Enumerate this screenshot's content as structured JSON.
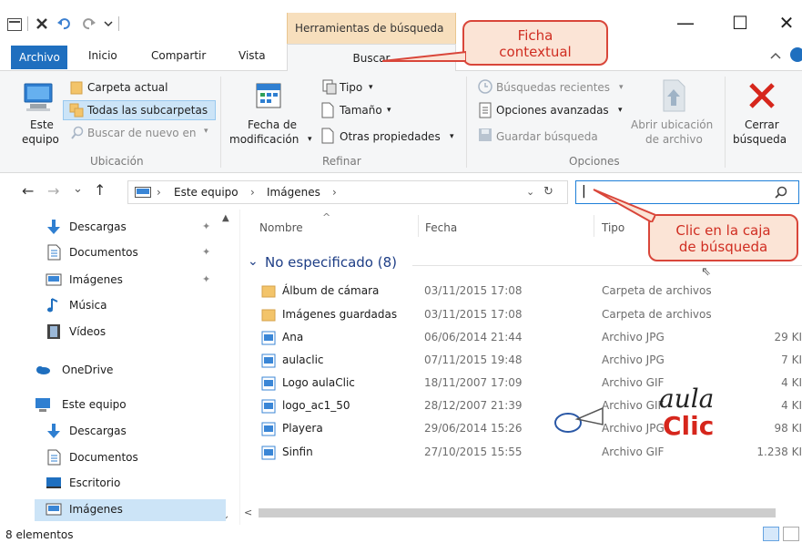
{
  "quick_access": {
    "undo_icon": "undo-arrow-icon",
    "redo_icon": "redo-arrow-icon"
  },
  "window": {
    "contextual_tab_group": "Herramientas de búsqueda",
    "minimize": "—",
    "maximize": "☐",
    "close": "✕"
  },
  "tabs": {
    "archivo": "Archivo",
    "inicio": "Inicio",
    "compartir": "Compartir",
    "vista": "Vista",
    "buscar": "Buscar"
  },
  "ribbon": {
    "ubicacion": {
      "este_equipo_line1": "Este",
      "este_equipo_line2": "equipo",
      "carpeta_actual": "Carpeta actual",
      "todas_subcarpetas": "Todas las subcarpetas",
      "buscar_de_nuevo": "Buscar de nuevo en",
      "group_label": "Ubicación"
    },
    "refinar": {
      "fecha_line1": "Fecha de",
      "fecha_line2": "modificación",
      "tipo": "Tipo",
      "tamano": "Tamaño",
      "otras_propiedades": "Otras propiedades",
      "group_label": "Refinar"
    },
    "opciones": {
      "busquedas_recientes": "Búsquedas recientes",
      "opciones_avanzadas": "Opciones avanzadas",
      "guardar_busqueda": "Guardar búsqueda",
      "abrir_ubicacion_line1": "Abrir ubicación",
      "abrir_ubicacion_line2": "de archivo",
      "group_label": "Opciones"
    },
    "cerrar": {
      "line1": "Cerrar",
      "line2": "búsqueda"
    }
  },
  "address_bar": {
    "back": "←",
    "forward": "→",
    "recent": "⌄",
    "up": "↑",
    "crumbs": [
      "Este equipo",
      "Imágenes"
    ],
    "separator": "›",
    "search_value": "|"
  },
  "nav_pane": {
    "items": [
      {
        "label": "Descargas",
        "icon": "download-arrow-icon",
        "pinned": true
      },
      {
        "label": "Documentos",
        "icon": "document-icon",
        "pinned": true
      },
      {
        "label": "Imágenes",
        "icon": "images-folder-icon",
        "pinned": true
      },
      {
        "label": "Música",
        "icon": "music-note-icon",
        "pinned": false
      },
      {
        "label": "Vídeos",
        "icon": "video-icon",
        "pinned": false
      },
      {
        "label": "OneDrive",
        "icon": "cloud-icon",
        "pinned": false
      },
      {
        "label": "Este equipo",
        "icon": "computer-icon",
        "pinned": false
      },
      {
        "label": "Descargas",
        "icon": "download-arrow-icon",
        "pinned": false
      },
      {
        "label": "Documentos",
        "icon": "document-icon",
        "pinned": false
      },
      {
        "label": "Escritorio",
        "icon": "desktop-icon",
        "pinned": false
      },
      {
        "label": "Imágenes",
        "icon": "images-folder-icon",
        "pinned": false
      }
    ]
  },
  "columns": {
    "nombre": "Nombre",
    "fecha": "Fecha",
    "tipo": "Tipo"
  },
  "group": {
    "label": "No especificado (8)"
  },
  "files": [
    {
      "name": "Álbum de cámara",
      "date": "03/11/2015 17:08",
      "type": "Carpeta de archivos",
      "size": "",
      "icon": "folder-icon"
    },
    {
      "name": "Imágenes guardadas",
      "date": "03/11/2015 17:08",
      "type": "Carpeta de archivos",
      "size": "",
      "icon": "folder-icon"
    },
    {
      "name": "Ana",
      "date": "06/06/2014 21:44",
      "type": "Archivo JPG",
      "size": "29 KI",
      "icon": "image-file-icon"
    },
    {
      "name": "aulaclic",
      "date": "07/11/2015 19:48",
      "type": "Archivo JPG",
      "size": "7 KI",
      "icon": "image-file-icon"
    },
    {
      "name": "Logo aulaClic",
      "date": "18/11/2007 17:09",
      "type": "Archivo GIF",
      "size": "4 KI",
      "icon": "image-file-icon"
    },
    {
      "name": "logo_ac1_50",
      "date": "28/12/2007 21:39",
      "type": "Archivo GIF",
      "size": "4 KI",
      "icon": "image-file-icon"
    },
    {
      "name": "Playera",
      "date": "29/06/2014 15:26",
      "type": "Archivo JPG",
      "size": "98 KI",
      "icon": "image-file-icon"
    },
    {
      "name": "Sinfin",
      "date": "27/10/2015 15:55",
      "type": "Archivo GIF",
      "size": "1.238 KI",
      "icon": "image-file-icon"
    }
  ],
  "callouts": {
    "ficha_line1": "Ficha",
    "ficha_line2": "contextual",
    "clic_line1": "Clic en la caja",
    "clic_line2": "de búsqueda"
  },
  "watermark": {
    "line1": "aula",
    "line2": "Clic"
  },
  "status": {
    "count": "8 elementos"
  },
  "colors": {
    "accent": "#1f6fbf",
    "contextual": "#f7dfbd",
    "callout_border": "#d9463a",
    "callout_text": "#d02d21",
    "selection": "#cce4f7"
  }
}
